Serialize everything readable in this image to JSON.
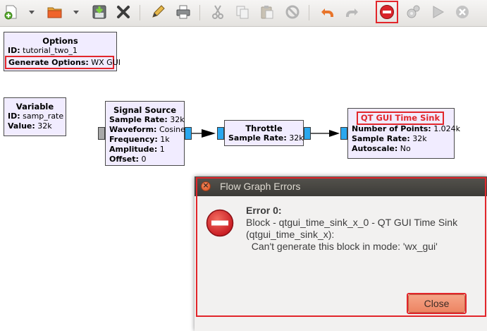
{
  "toolbar": {
    "icons": [
      "new-icon",
      "dropdown-arrow-icon",
      "open-icon",
      "dropdown-arrow-icon",
      "save-icon",
      "close-icon",
      "edit-icon",
      "print-icon",
      "cut-icon",
      "copy-icon",
      "paste-icon",
      "disable-icon",
      "undo-icon",
      "redo-icon",
      "kill-icon",
      "generate-icon",
      "execute-icon",
      "stop-icon"
    ]
  },
  "blocks": {
    "options": {
      "title": "Options",
      "id_label": "ID:",
      "id_value": "tutorial_two_1",
      "gen_label": "Generate Options:",
      "gen_value": "WX GUI"
    },
    "variable": {
      "title": "Variable",
      "id_label": "ID:",
      "id_value": "samp_rate",
      "value_label": "Value:",
      "value_value": "32k"
    },
    "signal_source": {
      "title": "Signal Source",
      "rows": [
        {
          "label": "Sample Rate:",
          "value": "32k"
        },
        {
          "label": "Waveform:",
          "value": "Cosine"
        },
        {
          "label": "Frequency:",
          "value": "1k"
        },
        {
          "label": "Amplitude:",
          "value": "1"
        },
        {
          "label": "Offset:",
          "value": "0"
        }
      ]
    },
    "throttle": {
      "title": "Throttle",
      "rows": [
        {
          "label": "Sample Rate:",
          "value": "32k"
        }
      ]
    },
    "time_sink": {
      "title": "QT GUI Time Sink",
      "rows": [
        {
          "label": "Number of Points:",
          "value": "1.024k"
        },
        {
          "label": "Sample Rate:",
          "value": "32k"
        },
        {
          "label": "Autoscale:",
          "value": "No"
        }
      ]
    }
  },
  "dialog": {
    "title": "Flow Graph Errors",
    "close_glyph": "×",
    "error_heading": "Error 0:",
    "error_lines": [
      "Block - qtgui_time_sink_x_0 - QT GUI Time Sink",
      "(qtgui_time_sink_x):",
      "  Can't generate this block in mode: 'wx_gui'"
    ],
    "close_button": "Close"
  },
  "colors": {
    "highlight": "#e2262b",
    "block_fill": "#f1ecff",
    "port_blue": "#2aa7ee",
    "button_orange": "#ed8563"
  }
}
